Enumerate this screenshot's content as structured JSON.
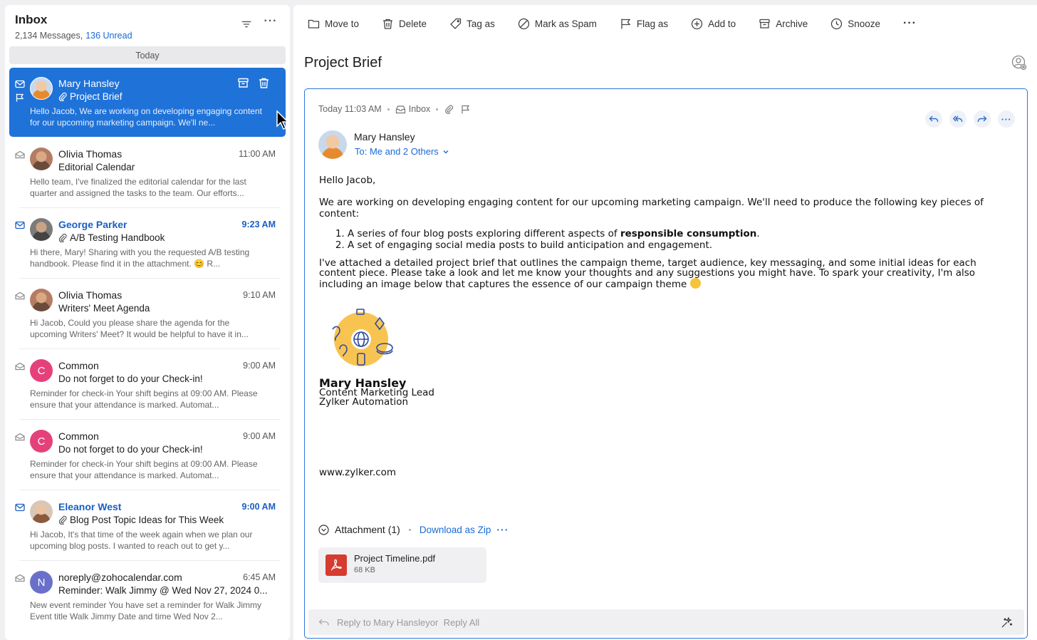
{
  "list": {
    "title": "Inbox",
    "count": "2,134 Messages,",
    "unread": "136 Unread",
    "group": "Today",
    "items": [
      {
        "sender": "Mary Hansley",
        "subject": "Project Brief",
        "time": "",
        "snippet": "Hello Jacob, We are working on developing engaging content for our upcoming marketing campaign. We'll ne...",
        "avatar_letter": ""
      },
      {
        "sender": "Olivia Thomas",
        "subject": "Editorial Calendar",
        "time": "11:00 AM",
        "snippet": "Hello team, I've finalized the editorial calendar for the last quarter and assigned the tasks to the team. Our efforts...",
        "avatar_letter": ""
      },
      {
        "sender": "George Parker",
        "subject": "A/B Testing Handbook",
        "time": "9:23 AM",
        "snippet": "Hi there, Mary! Sharing with you the requested A/B testing handbook. Please find it in the attachment. 😊 R...",
        "avatar_letter": ""
      },
      {
        "sender": "Olivia Thomas",
        "subject": "Writers' Meet Agenda",
        "time": "9:10 AM",
        "snippet": "Hi Jacob, Could you please share the agenda for the upcoming Writers' Meet? It would be helpful to have it in...",
        "avatar_letter": ""
      },
      {
        "sender": "Common",
        "subject": "Do not forget to do your Check-in!",
        "time": "9:00 AM",
        "snippet": "Reminder for check-in Your shift begins at 09:00 AM. Please ensure that your attendance is marked. Automat...",
        "avatar_letter": "C"
      },
      {
        "sender": "Common",
        "subject": "Do not forget to do your Check-in!",
        "time": "9:00 AM",
        "snippet": "Reminder for check-in Your shift begins at 09:00 AM. Please ensure that your attendance is marked. Automat...",
        "avatar_letter": "C"
      },
      {
        "sender": "Eleanor West",
        "subject": "Blog Post Topic Ideas for This Week",
        "time": "9:00 AM",
        "snippet": "Hi Jacob, It's that time of the week again when we plan our upcoming blog posts. I wanted to reach out to get y...",
        "avatar_letter": ""
      },
      {
        "sender": "noreply@zohocalendar.com",
        "subject": "Reminder: Walk Jimmy @ Wed Nov 27, 2024 0...",
        "time": "6:45 AM",
        "snippet": "New event reminder You have set a reminder for Walk Jimmy Event title Walk Jimmy Date and time Wed Nov 2...",
        "avatar_letter": "N"
      }
    ]
  },
  "toolbar": {
    "move_to": "Move to",
    "delete": "Delete",
    "tag_as": "Tag as",
    "mark_spam": "Mark as Spam",
    "flag_as": "Flag as",
    "add_to": "Add to",
    "archive": "Archive",
    "snooze": "Snooze"
  },
  "message": {
    "subject": "Project Brief",
    "date": "Today 11:03 AM",
    "folder": "Inbox",
    "sender": "Mary Hansley",
    "recipients": "To: Me and 2 Others",
    "greeting": "Hello Jacob,",
    "intro": "We are working on developing engaging content for our upcoming marketing campaign. We'll need to produce the following key pieces of content:",
    "list_1_prefix": "A series of four blog posts exploring different aspects of ",
    "list_1_bold": "responsible consumption",
    "list_1_suffix": ".",
    "list_2": "A set of engaging social media posts to build anticipation and engagement.",
    "attach_note": "I've attached a detailed project brief that outlines the campaign theme, target audience, key messaging, and some initial ideas for each content piece. Please take a look and let me know your thoughts and any suggestions you might have. To spark your creativity, I'm also including an image below that captures the essence of our campaign theme",
    "sig_name": "Mary Hansley",
    "sig_role": "Content Marketing Lead",
    "sig_company": "Zylker Automation",
    "sig_url": "www.zylker.com"
  },
  "attachments": {
    "label": "Attachment (1)",
    "download": "Download as Zip",
    "file_name": "Project Timeline.pdf",
    "file_size": "68 KB"
  },
  "reply": {
    "placeholder_reply": "Reply to Mary Hansley",
    "placeholder_or": "or",
    "placeholder_all": "Reply All"
  },
  "colors": {
    "accent": "#1f72d8",
    "unread": "#1a5fc4",
    "pdf": "#d63b30"
  }
}
